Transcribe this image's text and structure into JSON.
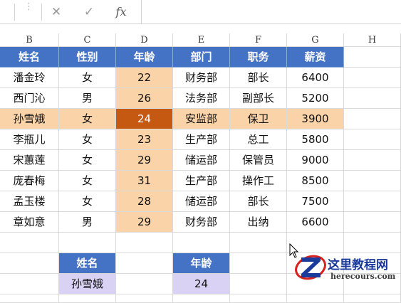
{
  "formula_bar": {
    "cancel_icon": "close-icon",
    "confirm_icon": "check-icon",
    "function_label": "fx",
    "content": ""
  },
  "columns": [
    "B",
    "C",
    "D",
    "E",
    "F",
    "G",
    "H"
  ],
  "table": {
    "headers": [
      "姓名",
      "性别",
      "年龄",
      "部门",
      "职务",
      "薪资"
    ],
    "rows": [
      [
        "潘金玲",
        "女",
        "22",
        "财务部",
        "部长",
        "6400"
      ],
      [
        "西门沁",
        "男",
        "26",
        "法务部",
        "副部长",
        "5200"
      ],
      [
        "孙雪娥",
        "女",
        "24",
        "安监部",
        "保卫",
        "3900"
      ],
      [
        "李瓶儿",
        "女",
        "23",
        "生产部",
        "总工",
        "5800"
      ],
      [
        "宋蕙莲",
        "女",
        "29",
        "储运部",
        "保管员",
        "9000"
      ],
      [
        "庞春梅",
        "女",
        "31",
        "生产部",
        "操作工",
        "8500"
      ],
      [
        "孟玉楼",
        "女",
        "28",
        "储运部",
        "部长",
        "7500"
      ],
      [
        "章如意",
        "男",
        "29",
        "财务部",
        "出纳",
        "6600"
      ]
    ],
    "highlight_row_index": 2,
    "highlight_column_index": 2
  },
  "lookup": {
    "name_label": "姓名",
    "name_value": "孙雪娥",
    "age_label": "年龄",
    "age_value": "24"
  },
  "watermark": {
    "title": "这里教程网",
    "url": "herecours.com"
  },
  "colors": {
    "header_bg": "#4472c4",
    "highlight": "#fbd3a9",
    "intersection": "#c65911",
    "lookup_value_bg": "#d9d2f5"
  }
}
